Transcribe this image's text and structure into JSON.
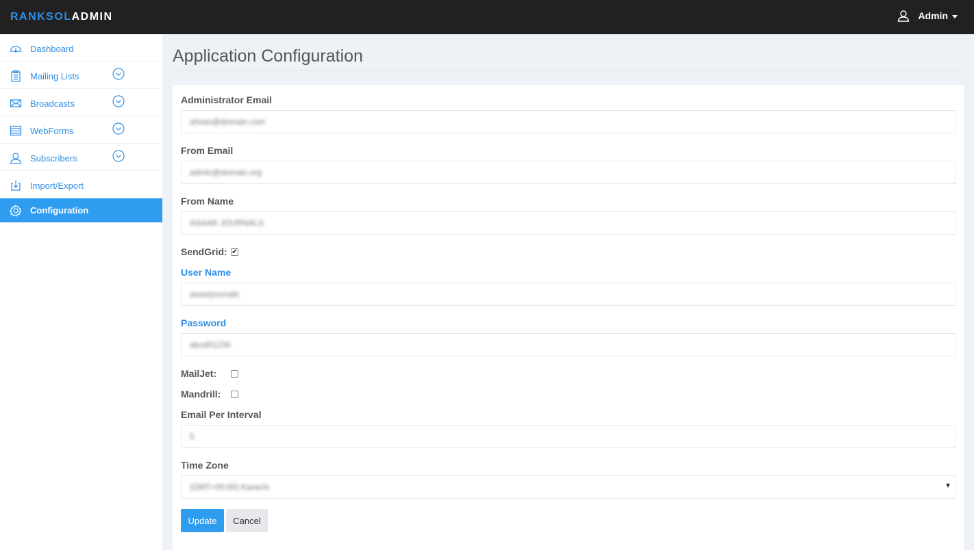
{
  "header": {
    "brand_part1": "RANKSOL",
    "brand_part2": "ADMIN",
    "user_label": "Admin",
    "accent": "#2e8fe6",
    "bar_color": "#212121"
  },
  "sidebar": {
    "items": [
      {
        "label": "Dashboard",
        "icon": "dashboard-icon",
        "expandable": false,
        "active": false
      },
      {
        "label": "Mailing Lists",
        "icon": "clipboard-icon",
        "expandable": true,
        "active": false
      },
      {
        "label": "Broadcasts",
        "icon": "envelope-icon",
        "expandable": true,
        "active": false
      },
      {
        "label": "WebForms",
        "icon": "form-icon",
        "expandable": true,
        "active": false
      },
      {
        "label": "Subscribers",
        "icon": "user-icon",
        "expandable": true,
        "active": false
      },
      {
        "label": "Import/Export",
        "icon": "download-icon",
        "expandable": false,
        "active": false
      },
      {
        "label": "Configuration",
        "icon": "gear-icon",
        "expandable": false,
        "active": true
      }
    ]
  },
  "page": {
    "title": "Application Configuration"
  },
  "form": {
    "admin_email": {
      "label": "Administrator Email",
      "value": "ahsan@domain.com"
    },
    "from_email": {
      "label": "From Email",
      "value": "admin@domain.org"
    },
    "from_name": {
      "label": "From Name",
      "value": "ASAAR JOURNALS"
    },
    "sendgrid": {
      "label": "SendGrid:",
      "checked": true
    },
    "user_name": {
      "label": "User Name",
      "value": "asaarjournals"
    },
    "password": {
      "label": "Password",
      "value": "abcd01234"
    },
    "mailjet": {
      "label": "MailJet:",
      "checked": false
    },
    "mandrill": {
      "label": "Mandrill:",
      "checked": false
    },
    "email_per_interval": {
      "label": "Email Per Interval",
      "value": "5"
    },
    "time_zone": {
      "label": "Time Zone",
      "selected": "(GMT+05:00) Karachi"
    },
    "update_label": "Update",
    "cancel_label": "Cancel"
  }
}
